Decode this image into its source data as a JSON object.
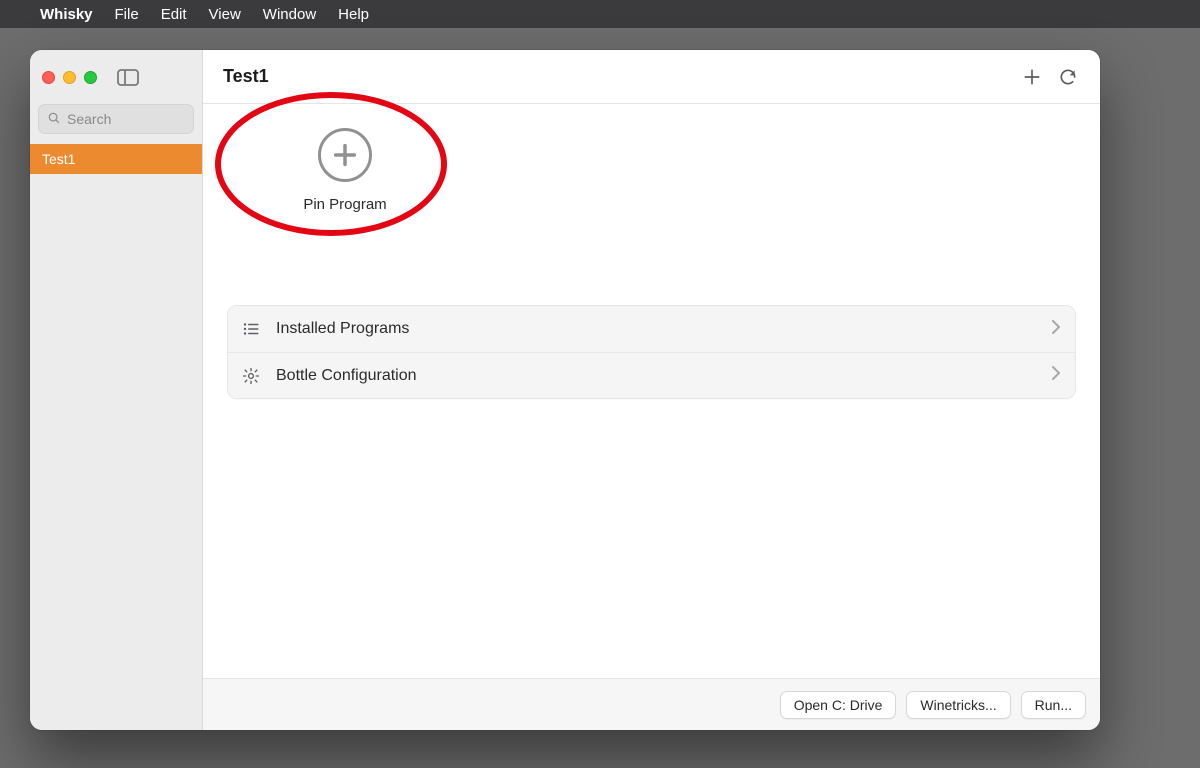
{
  "menubar": {
    "app_name": "Whisky",
    "items": [
      "File",
      "Edit",
      "View",
      "Window",
      "Help"
    ]
  },
  "window": {
    "title": "Test1"
  },
  "sidebar": {
    "search_placeholder": "Search",
    "items": [
      {
        "label": "Test1",
        "selected": true
      }
    ]
  },
  "main": {
    "pin_program_label": "Pin Program",
    "list": [
      {
        "icon": "list-icon",
        "label": "Installed Programs"
      },
      {
        "icon": "gear-icon",
        "label": "Bottle Configuration"
      }
    ]
  },
  "footer": {
    "buttons": [
      "Open C: Drive",
      "Winetricks...",
      "Run..."
    ]
  },
  "annotation": {
    "type": "red-ellipse",
    "target": "pin-program-button"
  }
}
